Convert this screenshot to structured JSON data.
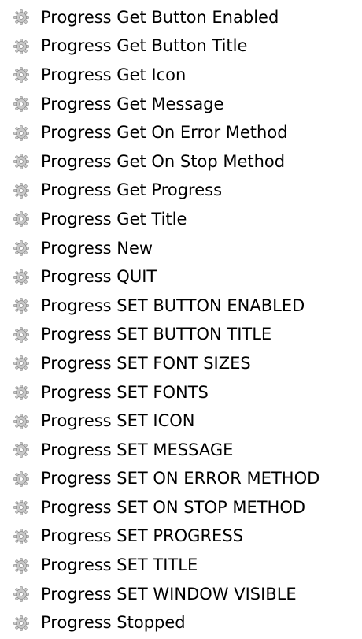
{
  "icon": "gear-icon",
  "colors": {
    "background": "#ffffff",
    "text": "#000000",
    "gear_fill": "#c9c9c9",
    "gear_stroke": "#8a8a8a"
  },
  "items": [
    {
      "label": "Progress Get Button Enabled"
    },
    {
      "label": "Progress Get Button Title"
    },
    {
      "label": "Progress Get Icon"
    },
    {
      "label": "Progress Get Message"
    },
    {
      "label": "Progress Get On Error Method"
    },
    {
      "label": "Progress Get On Stop Method"
    },
    {
      "label": "Progress Get Progress"
    },
    {
      "label": "Progress Get Title"
    },
    {
      "label": "Progress New"
    },
    {
      "label": "Progress QUIT"
    },
    {
      "label": "Progress SET BUTTON ENABLED"
    },
    {
      "label": "Progress SET BUTTON TITLE"
    },
    {
      "label": "Progress SET FONT SIZES"
    },
    {
      "label": "Progress SET FONTS"
    },
    {
      "label": "Progress SET ICON"
    },
    {
      "label": "Progress SET MESSAGE"
    },
    {
      "label": "Progress SET ON ERROR METHOD"
    },
    {
      "label": "Progress SET ON STOP METHOD"
    },
    {
      "label": "Progress SET PROGRESS"
    },
    {
      "label": "Progress SET TITLE"
    },
    {
      "label": "Progress SET WINDOW VISIBLE"
    },
    {
      "label": "Progress Stopped"
    }
  ]
}
